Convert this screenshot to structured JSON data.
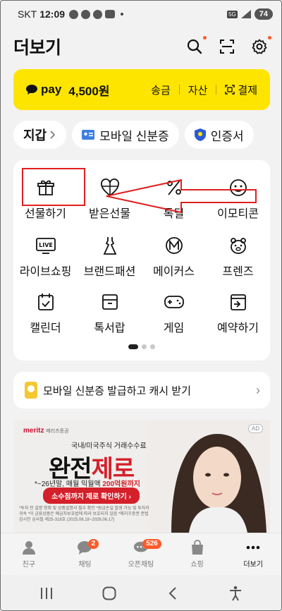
{
  "status": {
    "carrier": "SKT",
    "time": "12:09",
    "network": "5G",
    "battery": "74"
  },
  "header": {
    "title": "더보기"
  },
  "pay": {
    "brand": "pay",
    "amount": "4,500원",
    "links": [
      "송금",
      "자산",
      "결제"
    ]
  },
  "chips": {
    "wallet": "지갑",
    "mobile_id": "모바일 신분증",
    "certificate": "인증서"
  },
  "menu": {
    "items": [
      {
        "label": "선물하기",
        "icon": "gift-box-icon"
      },
      {
        "label": "받은선물",
        "icon": "received-gift-icon"
      },
      {
        "label": "톡딜",
        "icon": "discount-percent-icon"
      },
      {
        "label": "이모티콘",
        "icon": "emoticon-icon"
      },
      {
        "label": "라이브쇼핑",
        "icon": "live-tv-icon"
      },
      {
        "label": "브랜드패션",
        "icon": "dress-icon"
      },
      {
        "label": "메이커스",
        "icon": "makers-m-icon"
      },
      {
        "label": "프렌즈",
        "icon": "friends-bear-icon"
      },
      {
        "label": "캘린더",
        "icon": "calendar-icon"
      },
      {
        "label": "톡서랍",
        "icon": "drawer-icon"
      },
      {
        "label": "게임",
        "icon": "gamepad-icon"
      },
      {
        "label": "예약하기",
        "icon": "reservation-icon"
      }
    ],
    "pages": 3,
    "active_page": 1
  },
  "notice": {
    "text": "모바일 신분증 발급하고 캐시 받기"
  },
  "ad": {
    "brand": "meritz",
    "brand_sub": "메리츠증권",
    "badge": "AD",
    "subtitle": "국내/미국주식 거래수수료",
    "headline_black": "완전",
    "headline_red": "제로",
    "line2_prefix": "*~26년말, 매월 익월액 ",
    "line2_red": "200억원까지",
    "cta": "소수점까지 제로 확인하기 ›",
    "fine_print": "*투자 전 설명 청취 및 상품설명서 필수 확인 *원금손실 발생 가능 및 투자자 귀속 *이 금융상품은 예금자보호법에 따라 보호되지 않음 *메리츠증권 준법감시인 심사필 제25-318호 (2025.06.18~2026.06.17)"
  },
  "tabs": [
    {
      "label": "친구",
      "icon": "person-icon",
      "badge": ""
    },
    {
      "label": "채팅",
      "icon": "chat-icon",
      "badge": "2"
    },
    {
      "label": "오픈채팅",
      "icon": "open-chat-icon",
      "badge": "526"
    },
    {
      "label": "쇼핑",
      "icon": "shopping-bag-icon",
      "badge": ""
    },
    {
      "label": "더보기",
      "icon": "more-dots-icon",
      "badge": ""
    }
  ],
  "colors": {
    "pay_yellow": "#fee500",
    "accent_red": "#ff5a2a",
    "annotation_red": "#e02020"
  }
}
